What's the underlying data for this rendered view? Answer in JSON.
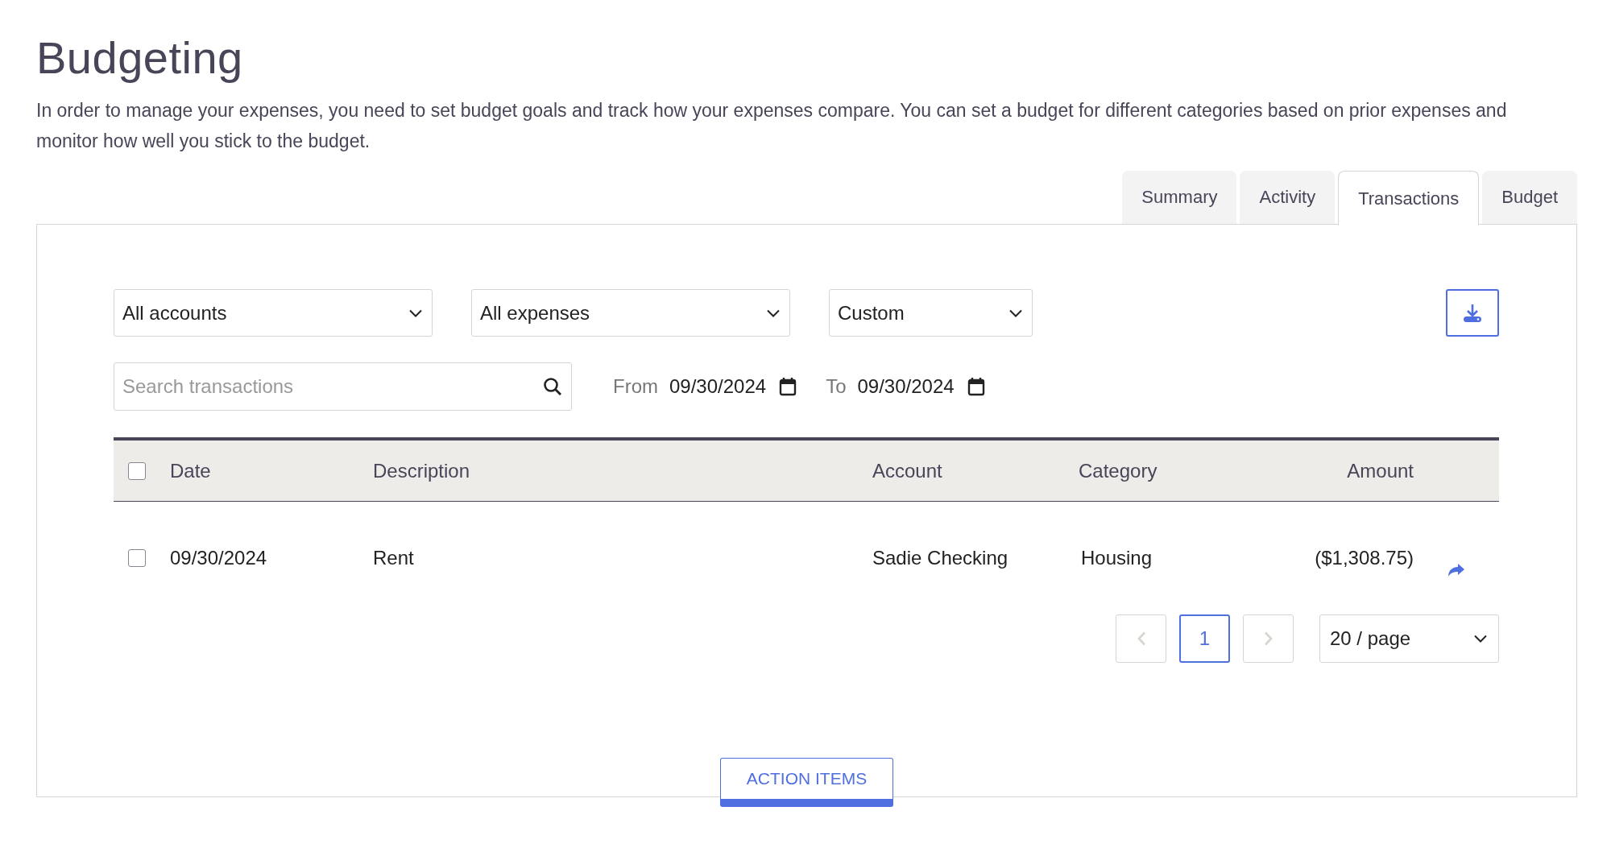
{
  "title": "Budgeting",
  "description": "In order to manage your expenses, you need to set budget goals and track how your expenses compare. You can set a budget for different categories based on prior expenses and monitor how well you stick to the budget.",
  "tabs": [
    {
      "label": "Summary",
      "selected": false
    },
    {
      "label": "Activity",
      "selected": false
    },
    {
      "label": "Transactions",
      "selected": true
    },
    {
      "label": "Budget",
      "selected": false
    }
  ],
  "filters": [
    {
      "value": "All accounts"
    },
    {
      "value": "All expenses"
    },
    {
      "value": "Custom"
    }
  ],
  "search": {
    "placeholder": "Search transactions"
  },
  "date_range": {
    "from_label": "From",
    "from": "09/30/2024",
    "to_label": "To",
    "to": "09/30/2024"
  },
  "table": {
    "select_all_checked": false,
    "columns": [
      "Date",
      "Description",
      "Account",
      "Category",
      "Amount"
    ],
    "rows": [
      {
        "checked": false,
        "date": "09/30/2024",
        "description": "Rent",
        "account": "Sadie Checking",
        "category": "Housing",
        "amount": "($1,308.75)"
      }
    ]
  },
  "pagination": {
    "prev_disabled": true,
    "next_disabled": true,
    "pages": [
      {
        "label": "1",
        "selected": true
      }
    ],
    "page_size": "20 / page"
  },
  "action_button": "ACTION ITEMS"
}
